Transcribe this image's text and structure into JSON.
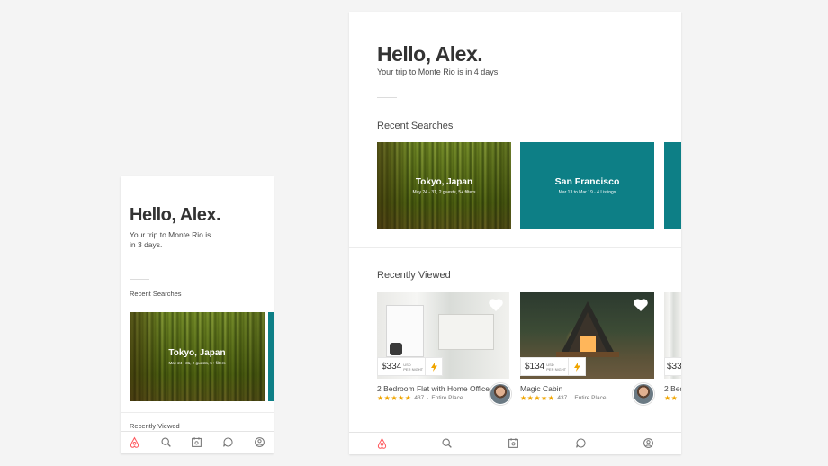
{
  "phone": {
    "greeting": "Hello, Alex.",
    "trip_line1": "Your trip to Monte Rio is",
    "trip_line2": "in 3 days.",
    "recent_searches_label": "Recent Searches",
    "searches": [
      {
        "title": "Tokyo, Japan",
        "subtitle": "May 24 - 31, 2 guests, 5+ filters"
      }
    ],
    "recently_viewed_label": "Recently Viewed"
  },
  "tablet": {
    "greeting": "Hello, Alex.",
    "trip_text": "Your trip to Monte Rio is in 4 days.",
    "recent_searches_label": "Recent Searches",
    "searches": [
      {
        "title": "Tokyo, Japan",
        "subtitle": "May 24 - 31, 2 guests, 5+ filters"
      },
      {
        "title": "San Francisco",
        "subtitle": "Mar 13 to Mar 19 · 4 Listings"
      }
    ],
    "recently_viewed_label": "Recently Viewed",
    "listings": [
      {
        "price": "$334",
        "currency": "USD",
        "per": "PER NIGHT",
        "title": "2 Bedroom Flat with Home Office",
        "stars": "★★★★★",
        "reviews": "437",
        "type": "Entire Place"
      },
      {
        "price": "$134",
        "currency": "USD",
        "per": "PER NIGHT",
        "title": "Magic Cabin",
        "stars": "★★★★★",
        "reviews": "437",
        "type": "Entire Place"
      },
      {
        "price": "$33",
        "title": "2 Bed",
        "stars": "★★"
      }
    ]
  },
  "nav_icons": [
    "airbnb-logo-icon",
    "search-icon",
    "trips-icon",
    "messages-icon",
    "profile-icon"
  ],
  "colors": {
    "accent": "#ff5a5f",
    "teal": "#0d7f86",
    "star": "#f0a500"
  }
}
